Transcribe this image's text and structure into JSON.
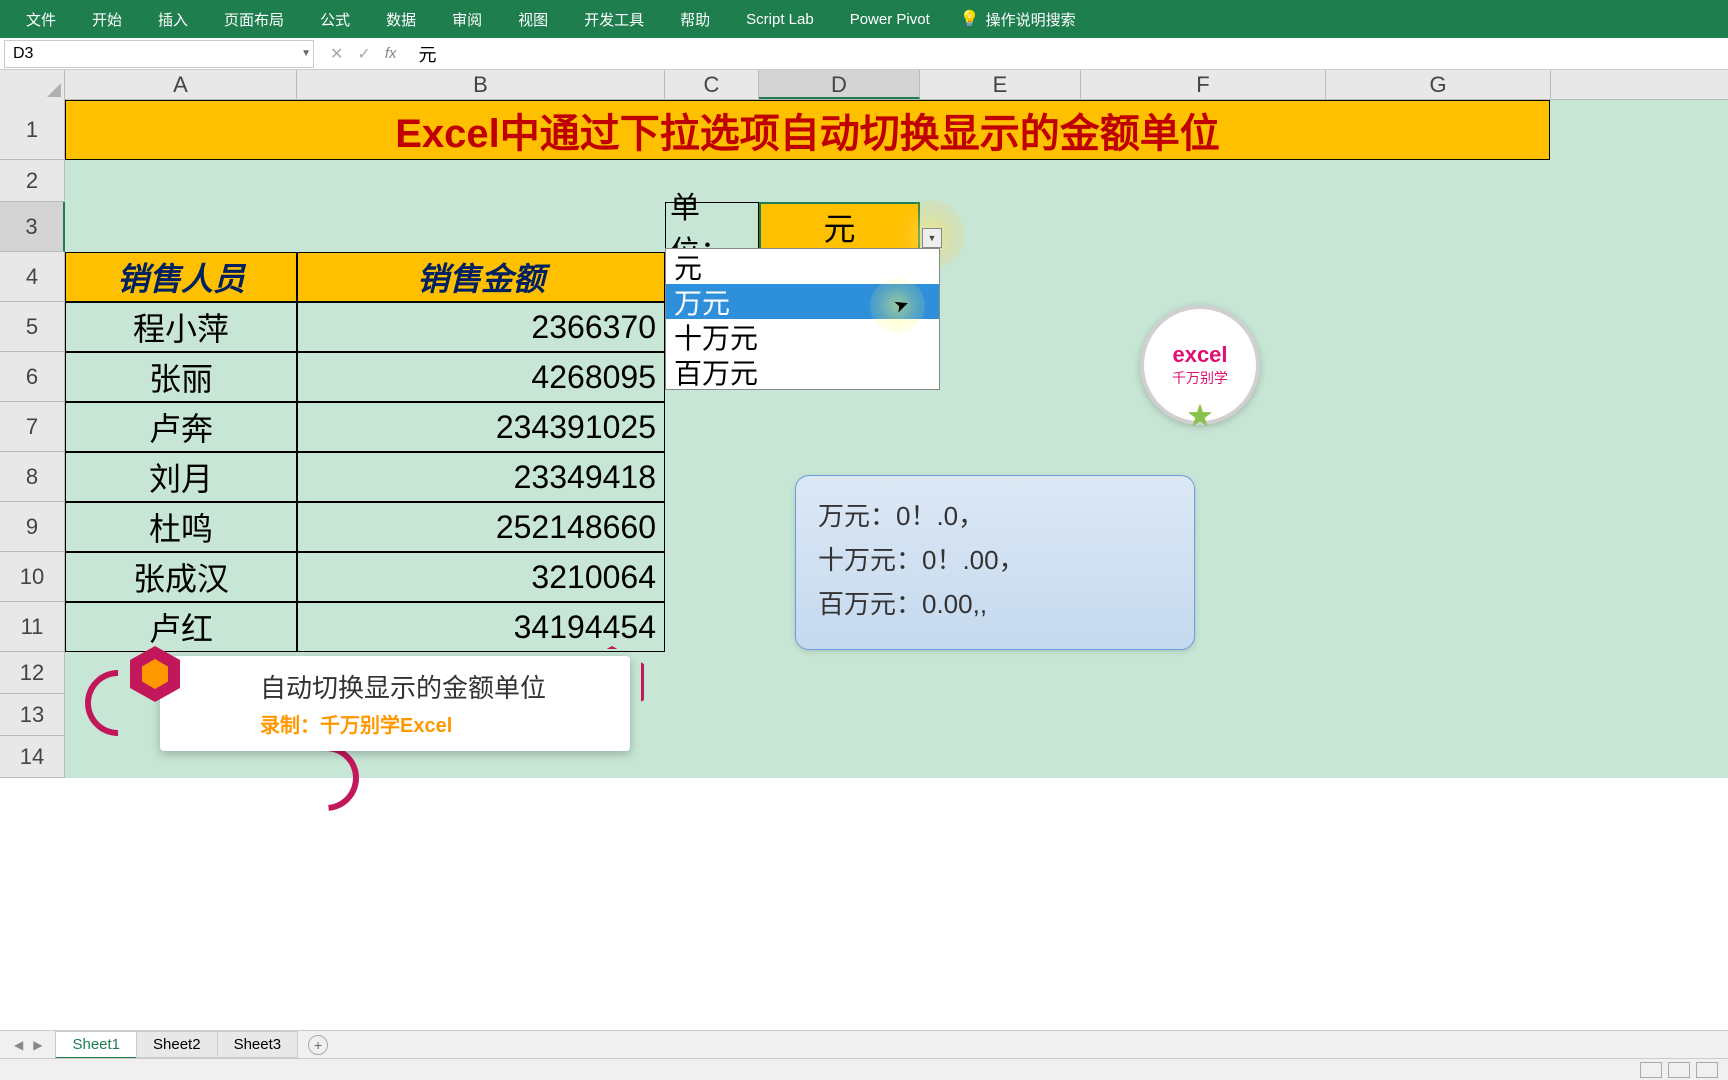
{
  "ribbon": {
    "tabs": [
      "文件",
      "开始",
      "插入",
      "页面布局",
      "公式",
      "数据",
      "审阅",
      "视图",
      "开发工具",
      "帮助",
      "Script Lab",
      "Power Pivot"
    ],
    "tellme": "操作说明搜索"
  },
  "nameBox": "D3",
  "formulaValue": "元",
  "columns": [
    "A",
    "B",
    "C",
    "D",
    "E",
    "F",
    "G"
  ],
  "rows": [
    "1",
    "2",
    "3",
    "4",
    "5",
    "6",
    "7",
    "8",
    "9",
    "10",
    "11",
    "12",
    "13",
    "14"
  ],
  "title": "Excel中通过下拉选项自动切换显示的金额单位",
  "table": {
    "headers": [
      "销售人员",
      "销售金额"
    ],
    "rows": [
      {
        "name": "程小萍",
        "amount": "2366370"
      },
      {
        "name": "张丽",
        "amount": "4268095"
      },
      {
        "name": "卢奔",
        "amount": "234391025"
      },
      {
        "name": "刘月",
        "amount": "23349418"
      },
      {
        "name": "杜鸣",
        "amount": "252148660"
      },
      {
        "name": "张成汉",
        "amount": "3210064"
      },
      {
        "name": "卢红",
        "amount": "34194454"
      }
    ]
  },
  "unit": {
    "label": "单位：",
    "selected": "元",
    "options": [
      "元",
      "万元",
      "十万元",
      "百万元"
    ],
    "hoverIndex": 1
  },
  "note": {
    "l1": "万元：0！.0，",
    "l2": "十万元：0！.00，",
    "l3": "百万元：0.00,,"
  },
  "logo": {
    "t1": "excel",
    "t2": "千万别学"
  },
  "overlay": {
    "t1": "自动切换显示的金额单位",
    "t2": "录制：千万别学Excel"
  },
  "sheets": [
    "Sheet1",
    "Sheet2",
    "Sheet3"
  ]
}
